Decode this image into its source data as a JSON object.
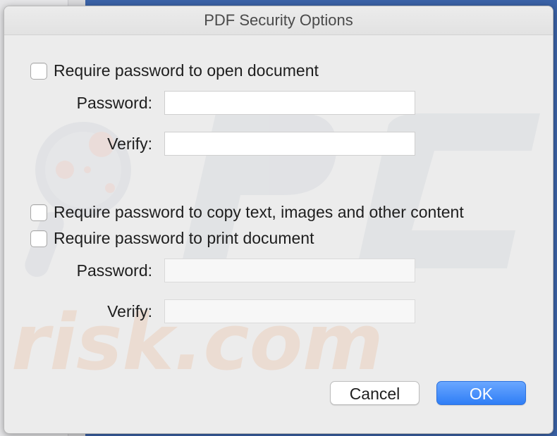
{
  "dialog": {
    "title": "PDF Security Options",
    "open_section": {
      "checkbox_label": "Require password to open document",
      "checked": false,
      "password_label": "Password:",
      "password_value": "",
      "verify_label": "Verify:",
      "verify_value": ""
    },
    "permissions_section": {
      "copy_checkbox_label": "Require password to copy text, images and other content",
      "copy_checked": false,
      "print_checkbox_label": "Require password to print document",
      "print_checked": false,
      "password_label": "Password:",
      "password_value": "",
      "verify_label": "Verify:",
      "verify_value": ""
    },
    "buttons": {
      "cancel_label": "Cancel",
      "ok_label": "OK"
    }
  },
  "watermark": {
    "text": "PC risk.com"
  },
  "colors": {
    "accent": "#2f7ef6",
    "dialog_bg": "#ececec",
    "backdrop": "#3b63a8"
  }
}
